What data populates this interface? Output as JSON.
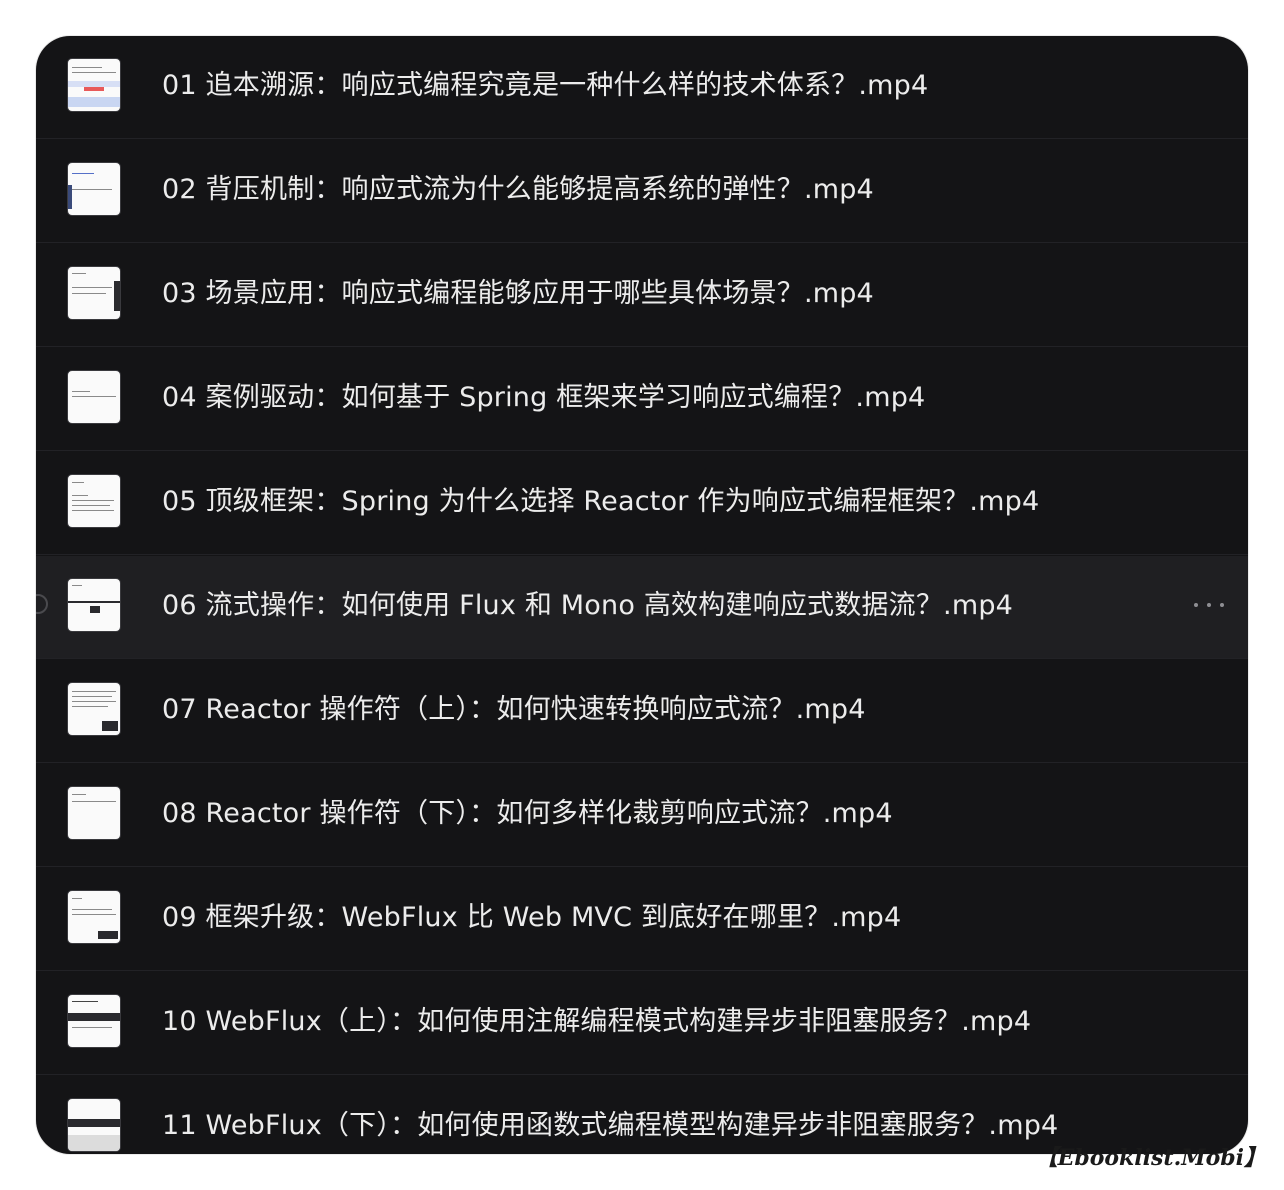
{
  "files": [
    {
      "name": "01 追本溯源：响应式编程究竟是一种什么样的技术体系？.mp4",
      "thumbnail": "slide-thumbnail-blue"
    },
    {
      "name": "02 背压机制：响应式流为什么能够提高系统的弹性？.mp4",
      "thumbnail": "slide-thumbnail-text"
    },
    {
      "name": "03 场景应用：响应式编程能够应用于哪些具体场景？.mp4",
      "thumbnail": "slide-thumbnail-text"
    },
    {
      "name": "04 案例驱动：如何基于 Spring 框架来学习响应式编程？.mp4",
      "thumbnail": "slide-thumbnail-text"
    },
    {
      "name": "05 顶级框架：Spring 为什么选择 Reactor 作为响应式编程框架？.mp4",
      "thumbnail": "slide-thumbnail-text"
    },
    {
      "name": "06 流式操作：如何使用 Flux 和 Mono 高效构建响应式数据流？.mp4",
      "thumbnail": "slide-thumbnail-dark-band",
      "selected": true
    },
    {
      "name": "07 Reactor 操作符（上）：如何快速转换响应式流？.mp4",
      "thumbnail": "slide-thumbnail-text"
    },
    {
      "name": "08 Reactor 操作符（下）：如何多样化裁剪响应式流？.mp4",
      "thumbnail": "slide-thumbnail-text"
    },
    {
      "name": "09 框架升级：WebFlux 比 Web MVC 到底好在哪里？.mp4",
      "thumbnail": "slide-thumbnail-text"
    },
    {
      "name": "10 WebFlux（上）：如何使用注解编程模式构建异步非阻塞服务？.mp4",
      "thumbnail": "slide-thumbnail-dark-band"
    },
    {
      "name": "11 WebFlux（下）：如何使用函数式编程模型构建异步非阻塞服务？.mp4",
      "thumbnail": "slide-thumbnail-dark-band"
    }
  ],
  "more_button": {
    "icon": "ellipsis-icon"
  },
  "watermark": "【Ebooklist.Mobi】"
}
